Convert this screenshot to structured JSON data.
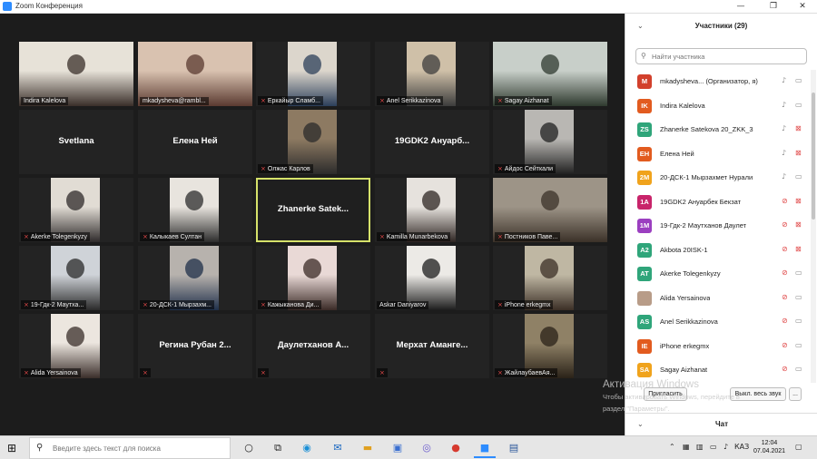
{
  "window": {
    "title": "Zoom Конференция",
    "minimize": "—",
    "restore": "❐",
    "close": "✕"
  },
  "tiles": [
    {
      "name": "Indira Kalelova",
      "muted": false,
      "video": true,
      "bg": "#e7e2d8",
      "fg": "#3a2f2a"
    },
    {
      "name": "mkadysheva@rambl...",
      "muted": false,
      "video": true,
      "bg": "#d9c2b0",
      "fg": "#5a3a30"
    },
    {
      "name": "Еркайыр Сламб...",
      "muted": true,
      "video": true,
      "bg": "#dcd6cc",
      "fg": "#2c3f5a"
    },
    {
      "name": "Anel Serikkazinova",
      "muted": true,
      "video": true,
      "bg": "#cfc0a8",
      "fg": "#3c3c3c"
    },
    {
      "name": "Sagay Aizhanat",
      "muted": true,
      "video": true,
      "bg": "#c8cfc9",
      "fg": "#2f3a2f"
    },
    {
      "name": "Svetlana",
      "muted": false,
      "video": false
    },
    {
      "name": "Елена Ней",
      "muted": false,
      "video": false
    },
    {
      "name": "Олжас Карлов",
      "muted": true,
      "video": true,
      "bg": "#8d7a62",
      "fg": "#2b2b2b"
    },
    {
      "name": "19GDK2 Ануарб...",
      "muted": false,
      "video": false
    },
    {
      "name": "Айдос Сейткали",
      "muted": true,
      "video": true,
      "bg": "#b9b7b3",
      "fg": "#202020"
    },
    {
      "name": "Akerke Tolegenkyzy",
      "muted": true,
      "video": true,
      "bg": "#e1dcd4",
      "fg": "#2e2a2a"
    },
    {
      "name": "Калыкаев Султан",
      "muted": true,
      "video": true,
      "bg": "#e8e4de",
      "fg": "#2c2c2c"
    },
    {
      "name": "Zhanerke Satek...",
      "muted": false,
      "video": false,
      "active": true
    },
    {
      "name": "Kamilla Munarbekova",
      "muted": true,
      "video": true,
      "bg": "#e6e2dd",
      "fg": "#2e2522"
    },
    {
      "name": "Постников Паве...",
      "muted": true,
      "video": true,
      "bg": "#9d9487",
      "fg": "#3b3128"
    },
    {
      "name": "19-Гдк-2 Маутха...",
      "muted": true,
      "video": true,
      "bg": "#cfd3d8",
      "fg": "#2a2a2a"
    },
    {
      "name": "20-ДСК-1 Мырзахм...",
      "muted": true,
      "video": true,
      "bg": "#b7b2ad",
      "fg": "#1f2f4a"
    },
    {
      "name": "Кажыканова Ди...",
      "muted": true,
      "video": true,
      "bg": "#e9d9d6",
      "fg": "#3a2a26"
    },
    {
      "name": "Askar Daniyarov",
      "muted": false,
      "video": true,
      "bg": "#eceae6",
      "fg": "#1c1c1c"
    },
    {
      "name": "iPhone erkegmx",
      "muted": true,
      "video": true,
      "bg": "#bfb7a3",
      "fg": "#3b2f26"
    },
    {
      "name": "Alida Yersainova",
      "muted": true,
      "video": true,
      "bg": "#ece6df",
      "fg": "#3a2e2a"
    },
    {
      "name": "Регина Рубан 2...",
      "muted": true,
      "video": false
    },
    {
      "name": "Даулетханов А...",
      "muted": true,
      "video": false
    },
    {
      "name": "Мерхат Амангe...",
      "muted": true,
      "video": false
    },
    {
      "name": "ЖайлаубаевАя...",
      "muted": true,
      "video": true,
      "bg": "#8f8166",
      "fg": "#2a2218"
    }
  ],
  "panel": {
    "title": "Участники (29)",
    "search_placeholder": "Найти участника",
    "participants": [
      {
        "initials": "M",
        "color": "#d2402c",
        "name": "mkadysheva... (Организатор, я)",
        "mic_muted": false,
        "cam_off": false
      },
      {
        "initials": "IK",
        "color": "#e25b1f",
        "name": "Indira Kalelova",
        "mic_muted": false,
        "cam_off": false
      },
      {
        "initials": "ZS",
        "color": "#2fa57a",
        "name": "Zhanerke Satekova 20_ZKK_3",
        "mic_muted": false,
        "cam_off": true
      },
      {
        "initials": "ЕН",
        "color": "#e25b1f",
        "name": "Елена Ней",
        "mic_muted": false,
        "cam_off": true
      },
      {
        "initials": "2М",
        "color": "#f0a31c",
        "name": "20-ДСК-1 Мырзахмет Нурали",
        "mic_muted": false,
        "cam_off": false
      },
      {
        "initials": "1А",
        "color": "#c8246a",
        "name": "19GDK2 Ануарбек Бекзат",
        "mic_muted": true,
        "cam_off": true
      },
      {
        "initials": "1М",
        "color": "#9b3fc0",
        "name": "19-Гдк-2 Маутханов Даулет",
        "mic_muted": true,
        "cam_off": true
      },
      {
        "initials": "A2",
        "color": "#2fa57a",
        "name": "Akbota 20ISK-1",
        "mic_muted": true,
        "cam_off": true
      },
      {
        "initials": "AT",
        "color": "#2fa57a",
        "name": "Akerke Tolegenkyzy",
        "mic_muted": true,
        "cam_off": false
      },
      {
        "initials": "",
        "color": "#b89c88",
        "name": "Alida Yersainova",
        "mic_muted": true,
        "cam_off": false
      },
      {
        "initials": "AS",
        "color": "#2fa57a",
        "name": "Anel Serikkazinova",
        "mic_muted": true,
        "cam_off": false
      },
      {
        "initials": "IE",
        "color": "#e25b1f",
        "name": "iPhone erkegmx",
        "mic_muted": true,
        "cam_off": false
      },
      {
        "initials": "SA",
        "color": "#f0a31c",
        "name": "Sagay Aizhanat",
        "mic_muted": true,
        "cam_off": false
      }
    ],
    "invite_label": "Пригласить",
    "mute_all_label": "Выкл. весь звук",
    "more_label": "...",
    "chat_title": "Чат"
  },
  "watermark": {
    "line1": "Активация Windows",
    "line2": "Чтобы активировать Windows, перейдите в",
    "line3": "раздел \"Параметры\"."
  },
  "taskbar": {
    "search_placeholder": "Введите здесь текст для поиска",
    "lang": "КАЗ",
    "time": "12:04",
    "date": "07.04.2021"
  }
}
